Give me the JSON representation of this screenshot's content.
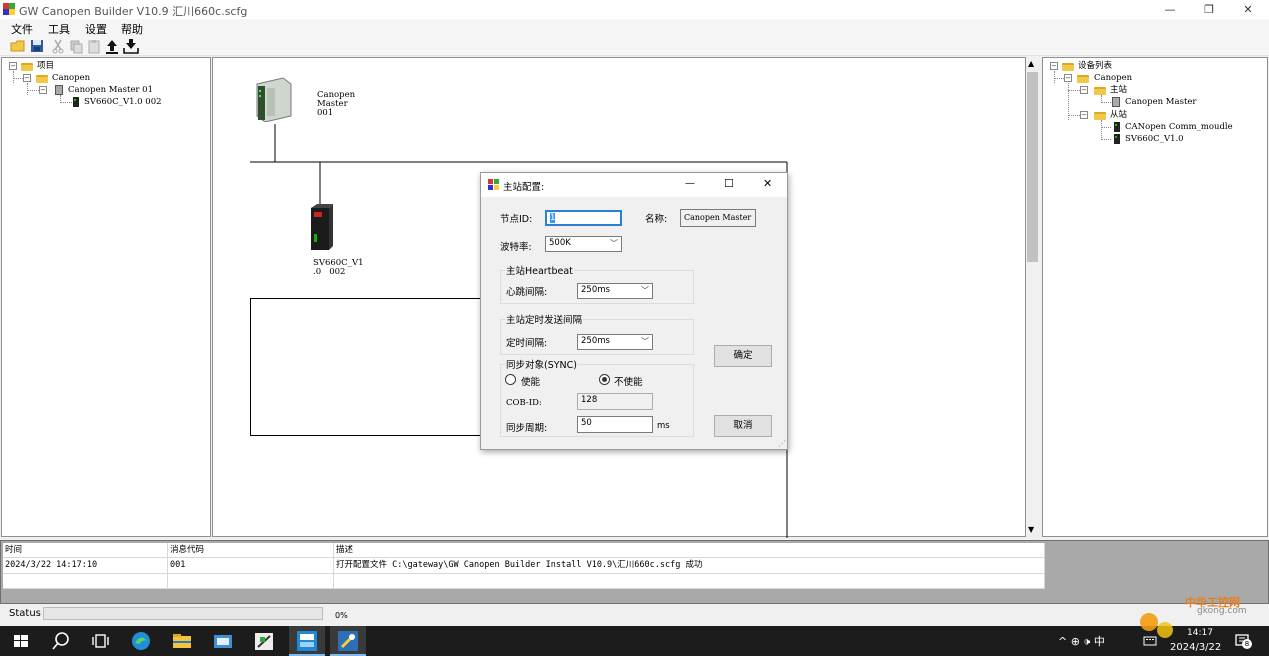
{
  "window": {
    "title": "GW Canopen Builder V10.9  汇川660c.scfg",
    "controls": [
      "—",
      "❐",
      "✕"
    ]
  },
  "menu": [
    "文件",
    "工具",
    "设置",
    "帮助"
  ],
  "project_tree": {
    "root": "项目",
    "canopen": "Canopen",
    "master": "Canopen Master  01",
    "slave": "SV660C_V1.0 002"
  },
  "device_tree": {
    "root": "设备列表",
    "canopen": "Canopen",
    "master_group": "主站",
    "master": "Canopen Master",
    "slave_group": "从站",
    "slave1": "CANopen Comm_moudle",
    "slave2": "SV660C_V1.0"
  },
  "diagram": {
    "master_label": "Canopen\nMaster\n001",
    "slave_label": "SV660C_V1\n.0   002"
  },
  "dialog": {
    "title": "主站配置:",
    "node_id_label": "节点ID:",
    "node_id": "1",
    "name_label": "名称:",
    "name": "Canopen Master",
    "baud_label": "波特率:",
    "baud": "500K",
    "heartbeat_group": "主站Heartbeat",
    "heartbeat_label": "心跳间隔:",
    "heartbeat": "250ms",
    "timer_group": "主站定时发送间隔",
    "timer_label": "定时间隔:",
    "timer": "250ms",
    "sync_group": "同步对象(SYNC)",
    "enable_label": "使能",
    "disable_label": "不使能",
    "cob_label": "COB-ID:",
    "cob_id": "128",
    "period_label": "同步周期:",
    "period": "50",
    "period_unit": "ms",
    "ok": "确定",
    "cancel": "取消",
    "controls": [
      "—",
      "☐",
      "✕"
    ]
  },
  "log": {
    "headers": [
      "时间",
      "消息代码",
      "描述"
    ],
    "rows": [
      [
        "2024/3/22 14:17:10",
        "001",
        "打开配置文件 C:\\gateway\\GW Canopen Builder Install V10.9\\汇川660c.scfg 成功"
      ]
    ]
  },
  "status": {
    "label": "Status",
    "progress": 0,
    "percent": "0%"
  },
  "taskbar": {
    "tray_symbols": "^ ⊕ 🕩 中",
    "time": "14:17",
    "date": "2024/3/22",
    "notif_count": "8",
    "watermark_top": "中华工控网",
    "watermark_bottom": "gkong.com"
  }
}
